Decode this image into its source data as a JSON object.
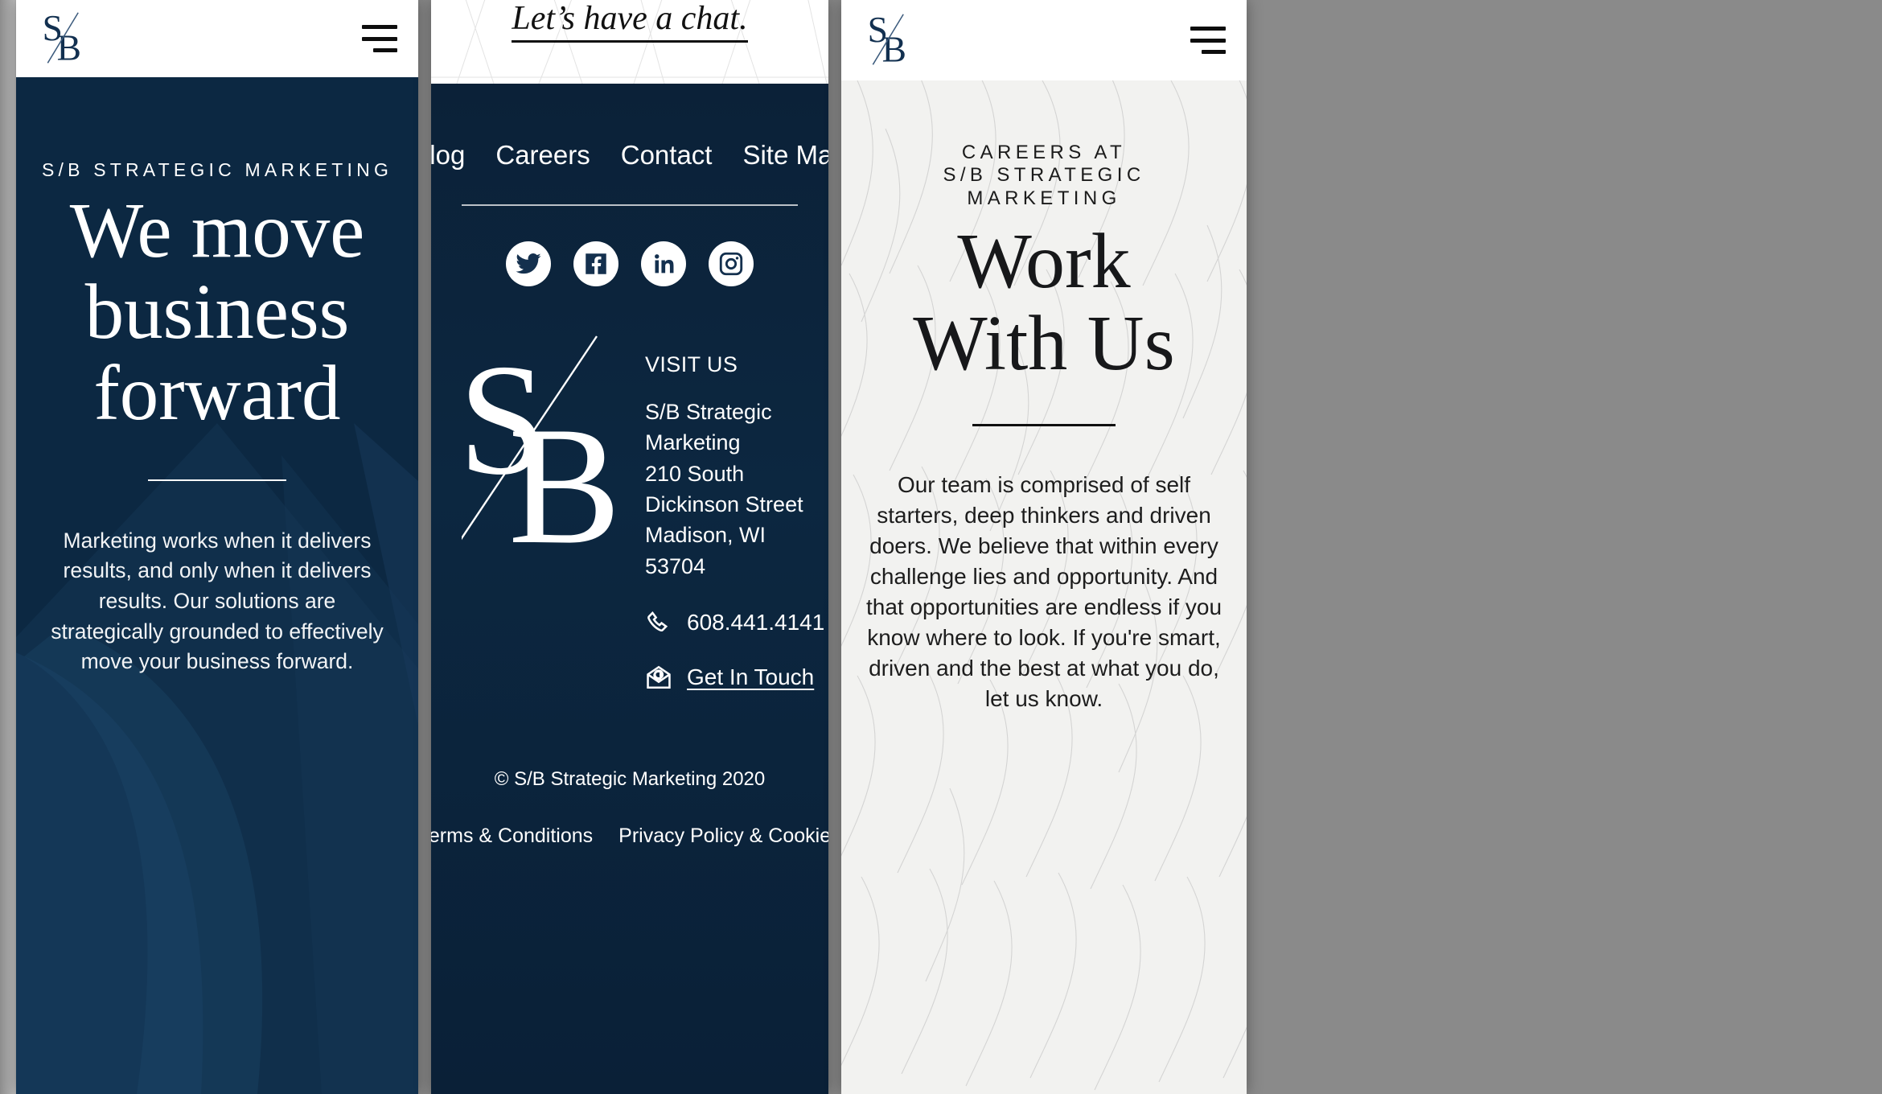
{
  "brand": {
    "name": "S/B Strategic Marketing",
    "monogram": "S/B"
  },
  "colors": {
    "navy": "#0c2842",
    "footer_navy": "#0b2138",
    "offwhite": "#f2f2f0",
    "white": "#ffffff",
    "ink": "#111111",
    "desk_grey": "#9b9b9b"
  },
  "panel_home": {
    "appbar": {
      "logo_alt": "S/B",
      "menu_label": "Menu"
    },
    "eyebrow": "S/B STRATEGIC MARKETING",
    "title_lines": [
      "We move",
      "business",
      "forward"
    ],
    "body": "Marketing works when it delivers results, and only when it delivers results. Our solutions are strategically grounded to effectively move your business forward."
  },
  "panel_footer": {
    "chat_cta": "Let’s have a chat.",
    "nav": [
      {
        "label": "Blog"
      },
      {
        "label": "Careers"
      },
      {
        "label": "Contact"
      },
      {
        "label": "Site Map"
      }
    ],
    "socials": [
      {
        "name": "twitter",
        "label": "Twitter"
      },
      {
        "name": "facebook",
        "label": "Facebook"
      },
      {
        "name": "linkedin",
        "label": "LinkedIn"
      },
      {
        "name": "instagram",
        "label": "Instagram"
      }
    ],
    "visit_label": "VISIT US",
    "address": {
      "line1": "S/B Strategic Marketing",
      "line2": "210 South Dickinson Street",
      "line3": "Madison, WI 53704"
    },
    "phone": "608.441.4141",
    "email_link": "Get In Touch",
    "copyright": "© S/B Strategic Marketing 2020",
    "legal": [
      {
        "label": "Terms & Conditions"
      },
      {
        "label": "Privacy Policy & Cookies"
      }
    ]
  },
  "panel_careers": {
    "appbar": {
      "logo_alt": "S/B",
      "menu_label": "Menu"
    },
    "eyebrow_line1": "CAREERS AT",
    "eyebrow_line2": "S/B STRATEGIC MARKETING",
    "title_lines": [
      "Work",
      "With Us"
    ],
    "body": "Our team is comprised of self starters, deep thinkers and driven doers. We believe that within every challenge lies and opportunity. And that opportunities are endless if you know where to look. If you're smart, driven and the best at what you do, let us know."
  }
}
